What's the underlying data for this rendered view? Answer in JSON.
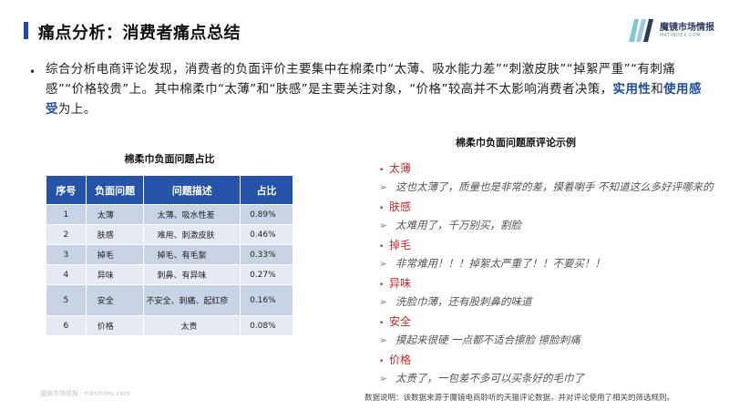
{
  "header": {
    "title": "痛点分析：消费者痛点总结"
  },
  "logo": {
    "name": "魔镜市场情报",
    "url": "MKTINDEX.COM"
  },
  "summary": {
    "part1": "综合分析电商评论发现，消费者的负面评价主要集中在棉柔巾“太薄、吸水能力差”“刺激皮肤”“掉絮严重”“有刺痛感”“价格较贵”上。其中棉柔巾“太薄”和“肤感”是主要关注对象，“价格”较高并不太影响消费者决策，",
    "highlight1": "实用性",
    "connector": "和",
    "highlight2": "使用感受",
    "part2": "为上。"
  },
  "table": {
    "title": "棉柔巾负面问题占比",
    "headers": [
      "序号",
      "负面问题",
      "问题描述",
      "占比"
    ],
    "rows": [
      {
        "no": "1",
        "issue": "太薄",
        "desc": "太薄、吸水性差",
        "pct": "0.89%"
      },
      {
        "no": "2",
        "issue": "肤感",
        "desc": "难用、刺激皮肤",
        "pct": "0.46%"
      },
      {
        "no": "3",
        "issue": "掉毛",
        "desc": "掉毛、有毛絮",
        "pct": "0.33%"
      },
      {
        "no": "4",
        "issue": "异味",
        "desc": "刺鼻、有异味",
        "pct": "0.27%"
      },
      {
        "no": "5",
        "issue": "安全",
        "desc": "不安全、刺痛、起红疹",
        "pct": "0.16%"
      },
      {
        "no": "6",
        "issue": "价格",
        "desc": "太贵",
        "pct": "0.08%"
      }
    ]
  },
  "reviews": {
    "title": "棉柔巾负面问题原评论示例",
    "items": [
      {
        "category": "太薄",
        "quote": "这也太薄了，质量也是非常的差，摸着喇手 不知道这么多好评哪来的"
      },
      {
        "category": "肤感",
        "quote": "太难用了，千万别买，割脸"
      },
      {
        "category": "掉毛",
        "quote": "非常难用！！！掉絮太严重了！！不要买！！"
      },
      {
        "category": "异味",
        "quote": "洗脸巾薄，还有股刺鼻的味道"
      },
      {
        "category": "安全",
        "quote": "摸起来很硬 一点都不适合擦脸 擦脸刺痛"
      },
      {
        "category": "价格",
        "quote": "太贵了，一包差不多可以买条好的毛巾了"
      }
    ]
  },
  "footer": {
    "left": "魔镜市场情报 · mktindex.com",
    "note": "数据说明：该数据来源于魔镜电商聆听的天猫评论数据，并对评论使用了相关的筛选规则。"
  },
  "colors": {
    "accent": "#1f4e9e",
    "table_header": "#2453a8",
    "row_odd": "#c9d3e6",
    "row_even": "#e6eaf3",
    "category_red": "#c0282d"
  }
}
